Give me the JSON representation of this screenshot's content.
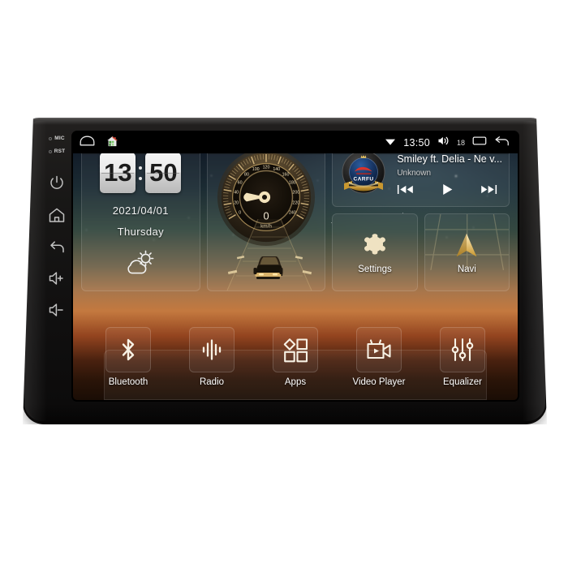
{
  "device": {
    "hardkeys": [
      {
        "name": "mic",
        "label": "MIC"
      },
      {
        "name": "rst",
        "label": "RST"
      },
      {
        "name": "power",
        "label": "power-icon"
      },
      {
        "name": "home",
        "label": "home-icon"
      },
      {
        "name": "back",
        "label": "back-icon"
      },
      {
        "name": "volume-up",
        "label": "volume-up-icon"
      },
      {
        "name": "volume-down",
        "label": "volume-down-icon"
      }
    ]
  },
  "statusbar": {
    "left_icons": [
      "rounded-trapezoid-icon",
      "house-icon"
    ],
    "wifi_icon": "wifi-icon",
    "time": "13:50",
    "volume_icon": "volume-icon",
    "volume_level": "18",
    "recents_icon": "recent-apps-icon",
    "back_icon": "back-arrow-icon"
  },
  "clock_widget": {
    "hours": "13",
    "minutes": "50",
    "date": "2021/04/01",
    "day": "Thursday",
    "weather_icon": "sun-behind-cloud-icon"
  },
  "speedometer_widget": {
    "value": "0",
    "unit": "km/h",
    "scale_labels": [
      "0",
      "20",
      "40",
      "60",
      "80",
      "100",
      "120",
      "140",
      "160",
      "180",
      "200",
      "220",
      "240"
    ],
    "min": 0,
    "max": 240,
    "needle_icon": "speed-needle-icon",
    "car_icon": "car-on-road-icon"
  },
  "music_widget": {
    "album_art": "carfu-logo",
    "album_art_text": "CARFU",
    "title": "Smiley ft. Delia - Ne v...",
    "artist": "Unknown",
    "prev_icon": "skip-previous-icon",
    "play_icon": "play-icon",
    "next_icon": "skip-next-icon"
  },
  "tiles": [
    {
      "label": "Settings",
      "icon": "gear-icon"
    },
    {
      "label": "Navi",
      "icon": "navigation-arrow-icon"
    }
  ],
  "dock": [
    {
      "label": "Bluetooth",
      "icon": "bluetooth-icon"
    },
    {
      "label": "Radio",
      "icon": "radio-waveform-icon"
    },
    {
      "label": "Apps",
      "icon": "apps-grid-icon"
    },
    {
      "label": "Video Player",
      "icon": "video-camera-icon"
    },
    {
      "label": "Equalizer",
      "icon": "equalizer-sliders-icon"
    }
  ],
  "colors": {
    "accent_gold": "#e6cf9a",
    "screen_black": "#000000",
    "bezel": "#161514"
  }
}
